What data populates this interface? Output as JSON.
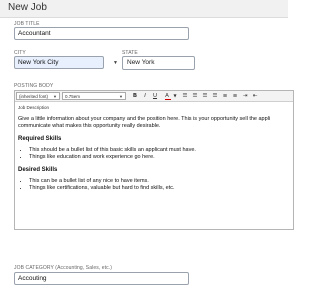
{
  "header": {
    "title": "New Job"
  },
  "job_title": {
    "label": "JOB TITLE",
    "value": "Accountant"
  },
  "city": {
    "label": "CITY",
    "value": "New York City"
  },
  "state": {
    "label": "STATE",
    "value": "New York"
  },
  "posting_body": {
    "label": "POSTING BODY",
    "toolbar": {
      "font": "(inherited font)",
      "size": "0.75em"
    },
    "caption": "Job Description",
    "intro": "Give a little information about your company and the position here.  This is your opportunity sell the appli communicate what makes this opportunity really desirable.",
    "required_heading": "Required Skills",
    "required_items": [
      "This should be a bullet list of this basic skills an applicant must have.",
      "Things like education and work experience go here."
    ],
    "desired_heading": "Desired Skills",
    "desired_items": [
      "This can be a bullet list of any nice to have items.",
      "Things like certifications, valuable but hard to find skills, etc."
    ]
  },
  "job_category": {
    "label": "JOB CATEGORY (Accounting, Sales, etc.)",
    "value": "Accouting"
  },
  "colors": {
    "header_bg": "#f1f1f1",
    "field_highlight": "#e8f0fe",
    "field_border": "#9aa3ad"
  }
}
